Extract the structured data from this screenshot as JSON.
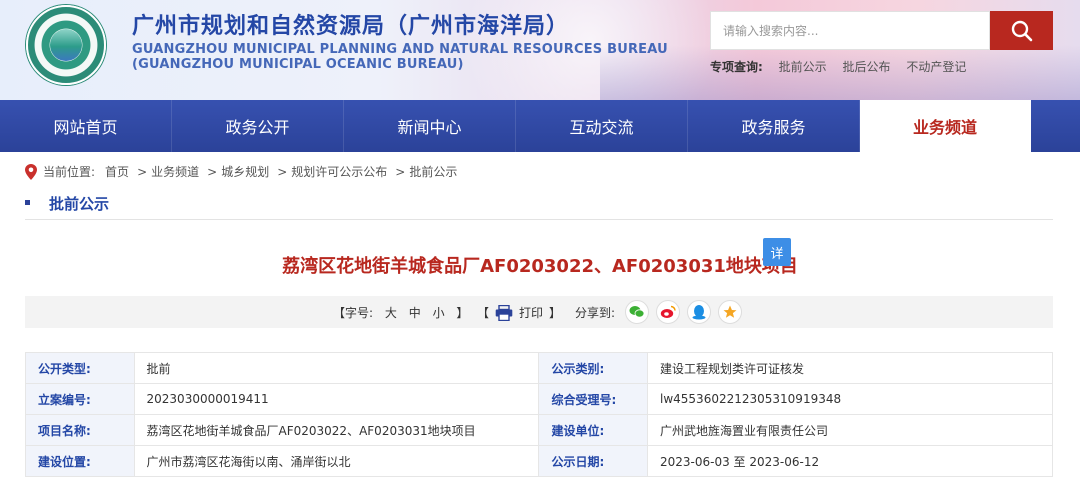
{
  "header": {
    "title_cn": "广州市规划和自然资源局（广州市海洋局）",
    "title_en_line1": "GUANGZHOU MUNICIPAL PLANNING AND NATURAL RESOURCES BUREAU",
    "title_en_line2": "(GUANGZHOU MUNICIPAL OCEANIC BUREAU)",
    "search_placeholder": "请输入搜索内容...",
    "quick_label": "专项查询:",
    "quick_links": [
      "批前公示",
      "批后公布",
      "不动产登记"
    ]
  },
  "nav": {
    "items": [
      "网站首页",
      "政务公开",
      "新闻中心",
      "互动交流",
      "政务服务",
      "业务频道"
    ],
    "active_index": 5
  },
  "breadcrumb": {
    "label": "当前位置:",
    "items": [
      "首页",
      "业务频道",
      "城乡规划",
      "规划许可公示公布",
      "批前公示"
    ],
    "separator": ">"
  },
  "section": {
    "title": "批前公示"
  },
  "article": {
    "title": "荔湾区花地街羊城食品厂AF0203022、AF0203031地块项目",
    "detail_badge": "详"
  },
  "tools": {
    "font_prefix": "【字号:",
    "font_large": "大",
    "font_medium": "中",
    "font_small": "小",
    "font_suffix": "】",
    "print_prefix": "【",
    "print_label": "打印",
    "print_suffix": "】",
    "share_label": "分享到:",
    "share_icons": [
      "wechat-icon",
      "weibo-icon",
      "qzone-icon",
      "favorite-icon"
    ]
  },
  "info": {
    "rows": [
      {
        "label1": "公开类型:",
        "value1": "批前",
        "label2": "公示类别:",
        "value2": "建设工程规划类许可证核发"
      },
      {
        "label1": "立案编号:",
        "value1": "2023030000019411",
        "label2": "综合受理号:",
        "value2": "lw45536022123053109193​48"
      },
      {
        "label1": "项目名称:",
        "value1": "荔湾区花地街羊城食品厂AF0203022、AF0203031地块项目",
        "label2": "建设单位:",
        "value2": "广州武地旌海置业有限责任公司"
      },
      {
        "label1": "建设位置:",
        "value1": "广州市荔湾区花海街以南、涌岸街以北",
        "label2": "公示日期:",
        "value2": "2023-06-03 至 2023-06-12"
      }
    ]
  },
  "colors": {
    "brand_blue": "#2b4299",
    "accent_red": "#b8281f",
    "label_bg": "#f1f4fb"
  }
}
